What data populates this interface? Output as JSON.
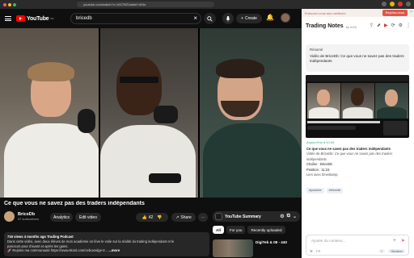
{
  "browser": {
    "url": "youtube.com/watch?v=16Z7BZVarkbl+d24s",
    "colors": {
      "red": "#ff5f57",
      "yellow": "#febc2e",
      "green": "#28c840"
    }
  },
  "youtube": {
    "logo_text": "YouTube",
    "logo_country": "FR",
    "search_value": "bricedb",
    "clear_icon": "close-icon",
    "create_label": "Create",
    "video_title": "Ce que vous ne savez pas des traders indépendants",
    "channel_name": "BriceDb",
    "channel_subs": "97 subscribers",
    "analytics_label": "Analytics",
    "edit_label": "Edit video",
    "likes": "42",
    "share_label": "Share",
    "description_meta": "716 views  4 months ago  Trading Podcast",
    "description_line1": "Dans cette vidéo, avec deux élèves de mon académie on lève le voile sur la réalité du trading indépendant et le",
    "description_line2": "parcours pour d'avant et après les gains.",
    "description_line3": "🚀 Rejoins ma communauté https://www.skool.com/ceboxedge-tr...",
    "more_label": "...more",
    "summary_label": "YouTube Summary",
    "chips": [
      "All",
      "For you",
      "Recently uploaded"
    ],
    "rec_title": "DigiTek & 08 - 440",
    "rec_channel": "DigiTek et 08",
    "brand_red": "#ff0000"
  },
  "sidebar": {
    "promo_text": "Entourez-vous des meilleurs",
    "promo_button": "Rejoins-nous",
    "title": "Trading Notes",
    "by": "by AGK",
    "resume_label": "Résumé",
    "resume_text": "Vidéo de BriceDb: Ce que vous ne savez pas des traders indépendants",
    "timestamp": "Aujourd'hui à 10:45",
    "note_title1": "Ce que vous ne savez pas des traders indépendants",
    "note_title2": "Vidéo de BriceDb: Ce que vous ne savez pas des traders indépendants",
    "note_chaine": "Chaîne : BriceDb",
    "note_position": "Position : 11:24",
    "note_link": "Lien avec timestamp",
    "tags": [
      "#youtube",
      "#bricedb"
    ],
    "composer_placeholder": "Ajouter du contenu...",
    "composer_lang": "FR",
    "composer_gen": "Générer"
  }
}
